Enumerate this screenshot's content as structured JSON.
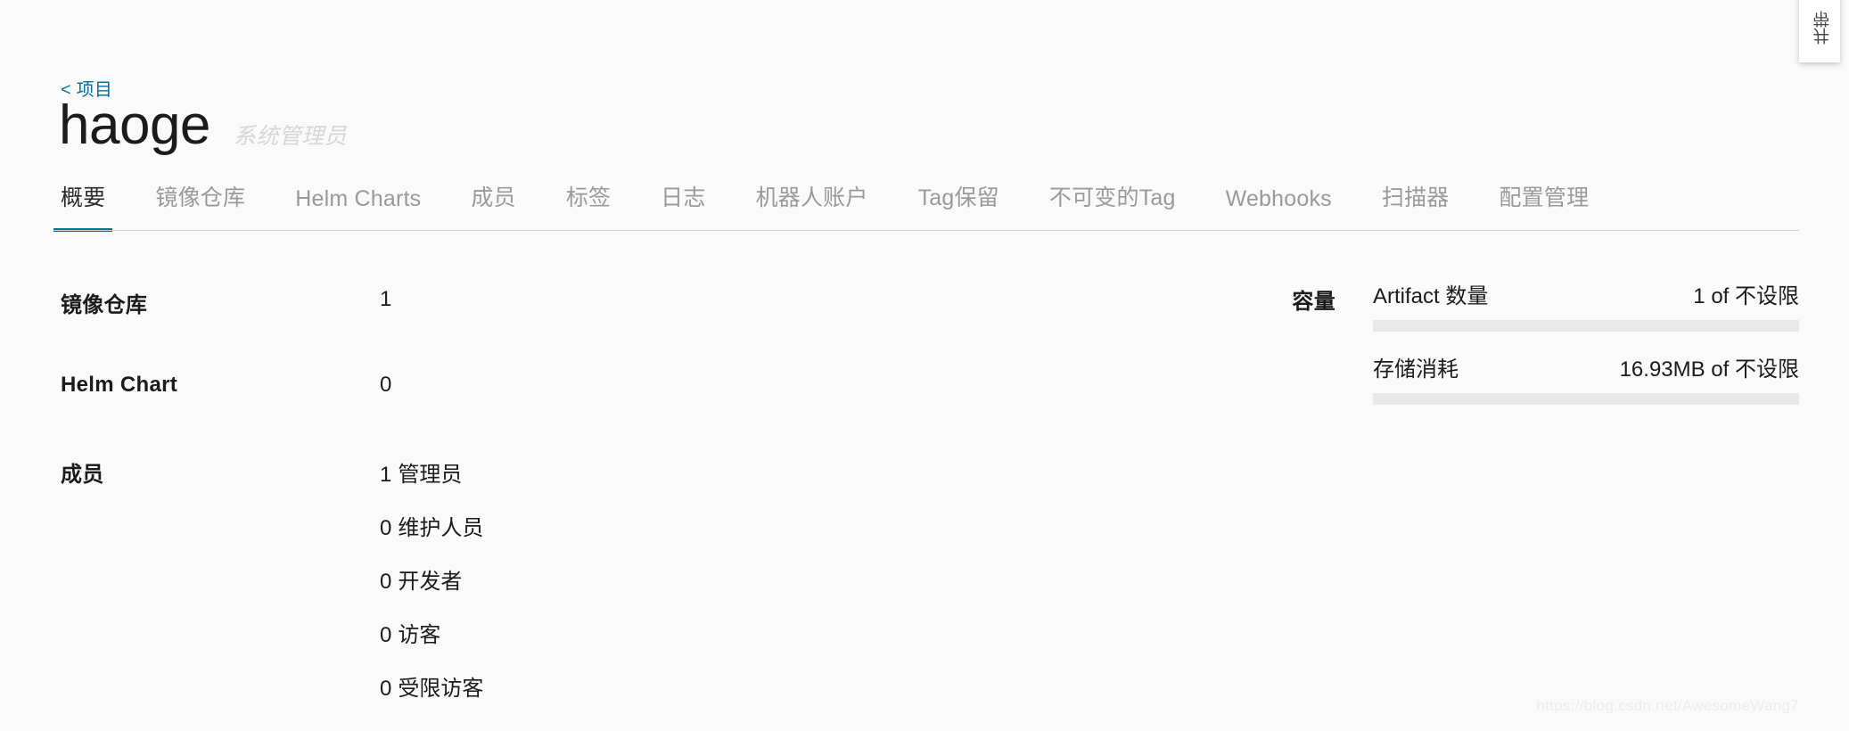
{
  "float_card": {
    "text": "井带",
    "name": "rotated-overlay-card"
  },
  "header": {
    "breadcrumb": "< 项目",
    "project_name": "haoge",
    "role_label": "系统管理员"
  },
  "tabs": [
    {
      "label": "概要",
      "active": true
    },
    {
      "label": "镜像仓库",
      "active": false
    },
    {
      "label": "Helm Charts",
      "active": false
    },
    {
      "label": "成员",
      "active": false
    },
    {
      "label": "标签",
      "active": false
    },
    {
      "label": "日志",
      "active": false
    },
    {
      "label": "机器人账户",
      "active": false
    },
    {
      "label": "Tag保留",
      "active": false
    },
    {
      "label": "不可变的Tag",
      "active": false
    },
    {
      "label": "Webhooks",
      "active": false
    },
    {
      "label": "扫描器",
      "active": false
    },
    {
      "label": "配置管理",
      "active": false
    }
  ],
  "summary": {
    "repositories": {
      "label": "镜像仓库",
      "value": "1"
    },
    "helm_chart": {
      "label": "Helm Chart",
      "value": "0"
    },
    "members": {
      "label": "成员",
      "items": [
        {
          "count": "1",
          "role": "管理员"
        },
        {
          "count": "0",
          "role": "维护人员"
        },
        {
          "count": "0",
          "role": "开发者"
        },
        {
          "count": "0",
          "role": "访客"
        },
        {
          "count": "0",
          "role": "受限访客"
        }
      ]
    }
  },
  "capacity": {
    "title": "容量",
    "rows": [
      {
        "label": "Artifact 数量",
        "value": "1 of 不设限",
        "percent": 0
      },
      {
        "label": "存储消耗",
        "value": "16.93MB of 不设限",
        "percent": 0
      }
    ]
  },
  "watermark": "https://blog.csdn.net/AwesomeWang7",
  "colors": {
    "accent": "#0072a3",
    "background": "#fafafa",
    "text": "#1b1b1b",
    "muted": "#9a9a9a",
    "bar_track": "#e8e8e8"
  }
}
